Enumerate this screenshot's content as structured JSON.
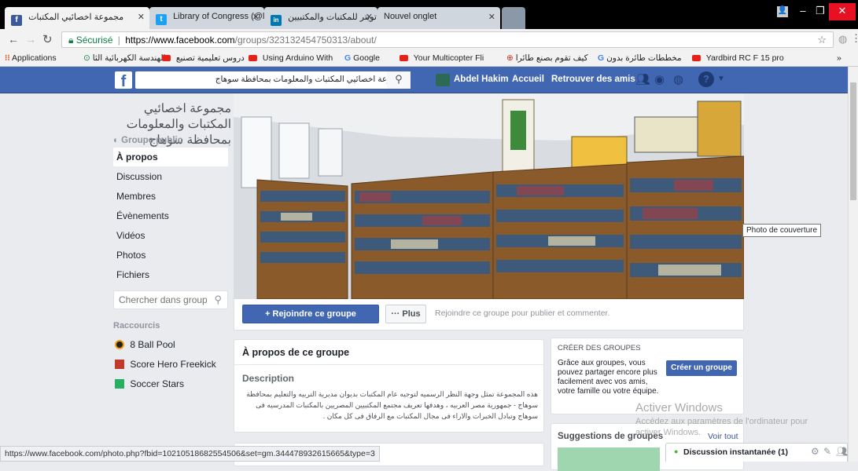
{
  "browser": {
    "tabs": [
      {
        "title": "مجموعة اخصائيي المكتبات",
        "icon": "facebook-icon",
        "color": "#3b5998",
        "glyph": "f"
      },
      {
        "title": "Library of Congress (@lib",
        "icon": "twitter-icon",
        "color": "#1da1f2",
        "glyph": "t"
      },
      {
        "title": "تويتر للمكتبات والمكتبيين",
        "icon": "linkedin-icon",
        "color": "#0077b5",
        "glyph": "in"
      },
      {
        "title": "Nouvel onglet",
        "icon": "",
        "color": "",
        "glyph": ""
      }
    ],
    "secure_label": "Sécurisé",
    "url_domain": "https://www.facebook.com",
    "url_path": "/groups/323132454750313/about/",
    "bookmarks": [
      {
        "label": "Applications",
        "icon": "apps-grid-icon"
      },
      {
        "label": "الهندسة الكهربائية الثا",
        "icon": "generic-link-icon"
      },
      {
        "label": "دروس تعليمية تصنيع",
        "icon": "youtube-icon"
      },
      {
        "label": "Using Arduino With",
        "icon": "youtube-icon"
      },
      {
        "label": "Google",
        "icon": "google-icon"
      },
      {
        "label": "Your Multicopter Fli",
        "icon": "youtube-icon"
      },
      {
        "label": "كيف تقوم بصنع طائرا",
        "icon": "generic-link-icon"
      },
      {
        "label": "مخططات طائرة بدون",
        "icon": "google-icon"
      },
      {
        "label": "Yardbird RC F 15 pro",
        "icon": "youtube-icon"
      }
    ],
    "bookmarks_more": "»",
    "status_url": "https://www.facebook.com/photo.php?fbid=10210518682554506&set=gm.344478932615665&type=3"
  },
  "fb": {
    "logo": "f",
    "search_value": "مجموعة اخصائيي المكتبات والمعلومات بمحافظة سوهاج",
    "user_name": "Abdel Hakim",
    "home": "Accueil",
    "find_friends": "Retrouver des amis"
  },
  "group": {
    "name": "مجموعة اخصائيي المكتبات والمعلومات بمحافظة سوهاج",
    "privacy": "Groupe public",
    "nav": [
      "À propos",
      "Discussion",
      "Membres",
      "Évènements",
      "Vidéos",
      "Photos",
      "Fichiers"
    ],
    "nav_active_index": 0,
    "search_placeholder": "Chercher dans groupe",
    "shortcuts_title": "Raccourcis",
    "shortcuts": [
      {
        "label": "8 Ball Pool",
        "icon": "8-ball-pool-icon"
      },
      {
        "label": "Score Hero Freekick",
        "icon": "score-hero-icon"
      },
      {
        "label": "Soccer Stars",
        "icon": "soccer-stars-icon"
      }
    ],
    "tooltip": "Photo de couverture",
    "join_button": "+ Rejoindre ce groupe",
    "more_button": "··· Plus",
    "join_hint": "Rejoindre ce groupe pour publier et commenter.",
    "about_title": "À propos de ce groupe",
    "description_label": "Description",
    "description_text": "هذه المجموعة تمثل وجهة النظر الرسميه لتوجيه عام المكتبات بديوان مديرية التربيه والتعليم بمحافظة سوهاج - جمهورية مصر العربيه ، وهدفها تعريف مجتمع المكتبيين المصريين بالمكتبات المدرسيه فى سوهاج وتبادل الخبرات والاراء فى مجال المكتبات مع الرفاق فى كل مكان ."
  },
  "right": {
    "create_title": "CRÉER DES GROUPES",
    "create_text": "Grâce aux groupes, vous pouvez partager encore plus facilement avec vos amis, votre famille ou votre équipe.",
    "create_button": "Créer un groupe",
    "suggest_title": "Suggestions de groupes",
    "see_all": "Voir tout",
    "chat_label": "Discussion instantanée (1)"
  },
  "watermark": {
    "line1": "Activer Windows",
    "line2": "Accédez aux paramètres de l'ordinateur pour",
    "line3": "activer Windows."
  }
}
